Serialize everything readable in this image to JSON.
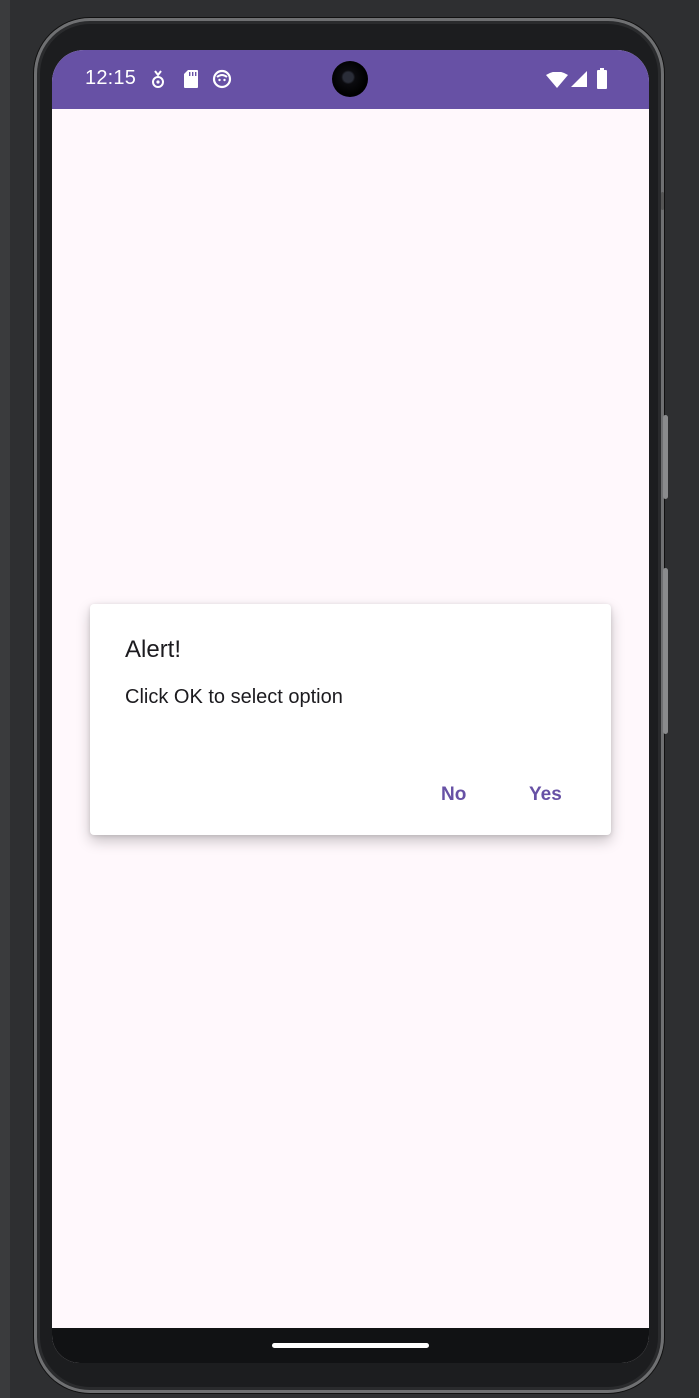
{
  "status_bar": {
    "time": "12:15",
    "left_icons": [
      "location-icon",
      "sd-card-icon",
      "app-notification-icon"
    ],
    "right_icons": [
      "wifi-icon",
      "signal-icon",
      "battery-icon"
    ],
    "color": "#6751a5"
  },
  "dialog": {
    "title": "Alert!",
    "message": "Click OK to select option",
    "negative_label": "No",
    "positive_label": "Yes",
    "button_color": "#6751a5"
  },
  "theme": {
    "background": "#fff8fc",
    "nav_bar": "#111214"
  }
}
